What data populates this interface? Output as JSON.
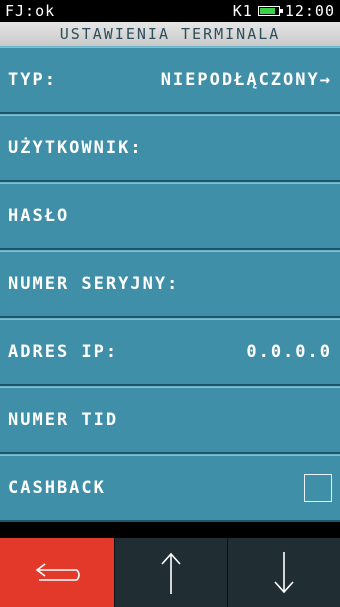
{
  "status": {
    "left": "FJ:ok",
    "channel": "K1",
    "time": "12:00",
    "battery_level": 0.78
  },
  "title": "USTAWIENIA TERMINALA",
  "rows": [
    {
      "label": "TYP:",
      "value": "NIEPODŁĄCZONY",
      "arrow": "→"
    },
    {
      "label": "UŻYTKOWNIK:",
      "value": ""
    },
    {
      "label": "HASŁO",
      "value": ""
    },
    {
      "label": "NUMER SERYJNY:",
      "value": ""
    },
    {
      "label": "ADRES IP:",
      "value": "0.0.0.0"
    },
    {
      "label": "NUMER TID",
      "value": ""
    },
    {
      "label": "CASHBACK",
      "checkbox": false
    }
  ],
  "colors": {
    "row_bg": "#3f8fa8",
    "back_button": "#e2392b",
    "nav_button": "#202d33",
    "battery": "#3bd14a"
  },
  "icons": {
    "back": "back-arrow-icon",
    "up": "arrow-up-icon",
    "down": "arrow-down-icon"
  }
}
